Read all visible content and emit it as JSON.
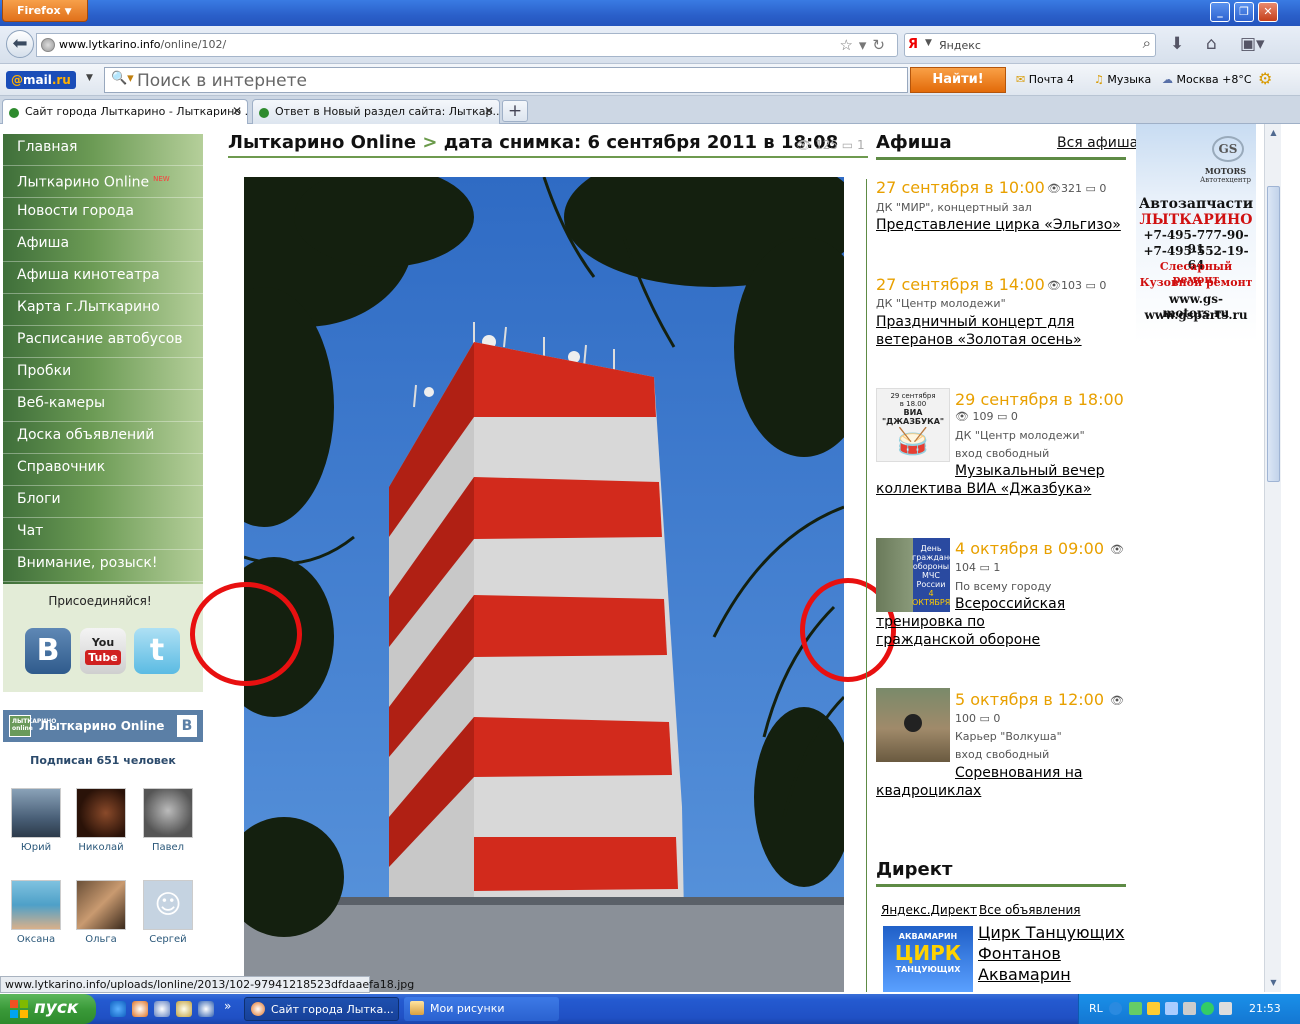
{
  "browser": {
    "menu_button": "Firefox",
    "url_host": "www.lytkarino.info",
    "url_path": "/online/102/",
    "search_engine_placeholder": "Яндекс",
    "tabs": [
      {
        "label": "Сайт города Лыткарино - Лыткарино ...",
        "close": "✕"
      },
      {
        "label": "Ответ в Новый раздел сайта: Лыткар...",
        "close": "✕"
      }
    ],
    "new_tab": "+"
  },
  "mailru": {
    "logo_prefix": "@",
    "logo_main": "mail",
    "logo_suffix": ".ru",
    "search_placeholder": "Поиск в интернете",
    "find_button": "Найти!",
    "mail_link": "Почта 4",
    "music_link": "Музыка",
    "weather": "Москва +8°C"
  },
  "nav": {
    "items": [
      {
        "label": "Главная"
      },
      {
        "label": "Лыткарино Online",
        "badge": "NEW"
      },
      {
        "label": "Новости города"
      },
      {
        "label": "Афиша"
      },
      {
        "label": "Афиша кинотеатра"
      },
      {
        "label": "Карта г.Лыткарино"
      },
      {
        "label": "Расписание автобусов"
      },
      {
        "label": "Пробки"
      },
      {
        "label": "Веб-камеры"
      },
      {
        "label": "Доска объявлений"
      },
      {
        "label": "Справочник"
      },
      {
        "label": "Блоги"
      },
      {
        "label": "Чат"
      },
      {
        "label": "Внимание, розыск!"
      }
    ],
    "join_text": "Присоединяйся!",
    "youtube_top": "You",
    "youtube_bottom": "Tube"
  },
  "vk_widget": {
    "name": "Лыткарино Online",
    "logo_text": "ЛЫТКАРИНО online",
    "subscribers": "Подписан 651 человек",
    "members": [
      "Юрий",
      "Николай",
      "Павел",
      "Оксана",
      "Ольга",
      "Сергей"
    ]
  },
  "main": {
    "title_link": "Лыткарино Online",
    "title_sep": ">",
    "title_rest": "дата снимка: 6 сентября 2011 в 18:08",
    "views": "125",
    "comments": "1"
  },
  "afisha": {
    "title": "Афиша",
    "all_link": "Вся афиша",
    "events": [
      {
        "date": "27 сентября в 10:00",
        "views": "321",
        "comments": "0",
        "place": "ДК \"МИР\", концертный зал",
        "entry": "",
        "link": "Представление цирка «Эльгизо»"
      },
      {
        "date": "27 сентября в 14:00",
        "views": "103",
        "comments": "0",
        "place": "ДК \"Центр молодежи\"",
        "entry": "",
        "link": "Праздничный концерт для ветеранов «Золотая осень»"
      },
      {
        "date": "29 сентября в 18:00",
        "views": "109",
        "comments": "0",
        "place": "ДК \"Центр молодежи\"",
        "entry": "вход свободный",
        "link": "Музыкальный вечер коллектива ВИА «Джазбука»"
      },
      {
        "date": "4 октября в 09:00",
        "views": "104",
        "comments": "1",
        "place": "По всему городу",
        "entry": "",
        "link": "Всероссийская тренировка по гражданской обороне"
      },
      {
        "date": "5 октября в 12:00",
        "views": "100",
        "comments": "0",
        "place": "Карьер \"Волкуша\"",
        "entry": "вход свободный",
        "link": "Соревнования на квадроциклах"
      }
    ],
    "thumb_texts": {
      "jazz_top": "29 сентября",
      "jazz_mid": "в 18.00",
      "jazz_main": "ВИА \"ДЖАЗБУКА\"",
      "civil_1": "День",
      "civil_2": "гражданской",
      "civil_3": "обороны",
      "civil_4": "МЧС России",
      "civil_5": "4 ОКТЯБРЯ"
    }
  },
  "direct": {
    "title": "Директ",
    "yandex_link": "Яндекс.Директ",
    "all_ads": "Все объявления",
    "ad_link": "Цирк Танцующих Фонтанов Аквамарин",
    "ad_img_top": "АКВАМАРИН",
    "ad_img_main": "ЦИРК",
    "ad_img_bottom": "ТАНЦУЮЩИХ"
  },
  "banner": {
    "logo": "GS",
    "brand": "MOTORS",
    "brand_sub": "Автотехцентр",
    "line1": "Автозапчасти",
    "line2": "ЛЫТКАРИНО",
    "phone1": "+7-495-777-90-91",
    "phone2": "+7-495-552-19-64",
    "service1": "Слесарный ремонт",
    "service2": "Кузовной ремонт",
    "site1": "www.gs-motors.ru",
    "site2": "www.gsparts.ru"
  },
  "status_url": "www.lytkarino.info/uploads/lonline/2013/102-97941218523dfdaaefa18.jpg",
  "taskbar": {
    "start": "пуск",
    "tasks": [
      "Сайт города Лытка...",
      "Мои рисунки"
    ],
    "lang": "RL",
    "clock": "21:53",
    "chevron": "»"
  },
  "colors": {
    "accent_green": "#5e8b45",
    "event_orange": "#e8a000",
    "annotation_red": "#e81010"
  }
}
